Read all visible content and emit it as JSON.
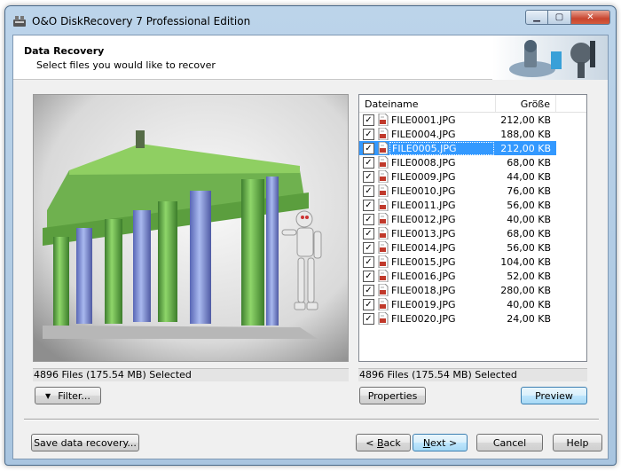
{
  "window": {
    "title": "O&O DiskRecovery 7 Professional Edition",
    "caption_minimize": "▁",
    "caption_maximize": "▢",
    "caption_close": "✕"
  },
  "header": {
    "title": "Data Recovery",
    "subtitle": "Select files you would like to recover"
  },
  "file_list": {
    "columns": {
      "name": "Dateiname",
      "size": "Größe"
    },
    "files": [
      {
        "name": "FILE0001.JPG",
        "size": "212,00 KB",
        "checked": true,
        "selected": false
      },
      {
        "name": "FILE0004.JPG",
        "size": "188,00 KB",
        "checked": true,
        "selected": false
      },
      {
        "name": "FILE0005.JPG",
        "size": "212,00 KB",
        "checked": true,
        "selected": true
      },
      {
        "name": "FILE0008.JPG",
        "size": "68,00 KB",
        "checked": true,
        "selected": false
      },
      {
        "name": "FILE0009.JPG",
        "size": "44,00 KB",
        "checked": true,
        "selected": false
      },
      {
        "name": "FILE0010.JPG",
        "size": "76,00 KB",
        "checked": true,
        "selected": false
      },
      {
        "name": "FILE0011.JPG",
        "size": "56,00 KB",
        "checked": true,
        "selected": false
      },
      {
        "name": "FILE0012.JPG",
        "size": "40,00 KB",
        "checked": true,
        "selected": false
      },
      {
        "name": "FILE0013.JPG",
        "size": "68,00 KB",
        "checked": true,
        "selected": false
      },
      {
        "name": "FILE0014.JPG",
        "size": "56,00 KB",
        "checked": true,
        "selected": false
      },
      {
        "name": "FILE0015.JPG",
        "size": "104,00 KB",
        "checked": true,
        "selected": false
      },
      {
        "name": "FILE0016.JPG",
        "size": "52,00 KB",
        "checked": true,
        "selected": false
      },
      {
        "name": "FILE0018.JPG",
        "size": "280,00 KB",
        "checked": true,
        "selected": false
      },
      {
        "name": "FILE0019.JPG",
        "size": "40,00 KB",
        "checked": true,
        "selected": false
      },
      {
        "name": "FILE0020.JPG",
        "size": "24,00 KB",
        "checked": true,
        "selected": false
      }
    ]
  },
  "status": {
    "left": "4896 Files (175.54 MB) Selected",
    "right": "4896 Files (175.54 MB) Selected"
  },
  "buttons": {
    "filter": "Filter...",
    "properties": "Properties",
    "preview": "Preview",
    "save": "Save data recovery...",
    "back_prefix": "< ",
    "back_key": "B",
    "back_rest": "ack",
    "next_key": "N",
    "next_rest": "ext >",
    "cancel": "Cancel",
    "help": "Help"
  },
  "icons": {
    "app": "disk-recovery-app-icon",
    "file": "jpg-file-icon",
    "checkbox_mark": "✓",
    "filter_arrow": "▼"
  },
  "colors": {
    "selection": "#3399ff",
    "frame": "#a9c5e0",
    "close_button": "#c8452f"
  }
}
